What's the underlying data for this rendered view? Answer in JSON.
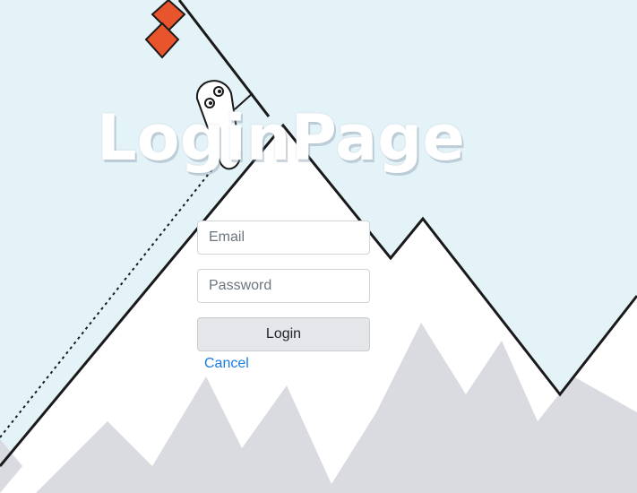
{
  "page": {
    "title": "LoginPage"
  },
  "form": {
    "email_placeholder": "Email",
    "password_placeholder": "Password",
    "login_label": "Login",
    "cancel_label": "Cancel"
  },
  "colors": {
    "sky": "#e4f3f8",
    "mountain": "#ffffff",
    "shadow": "#d9dbe0",
    "flag": "#e8542b",
    "link": "#1a7ae6"
  }
}
